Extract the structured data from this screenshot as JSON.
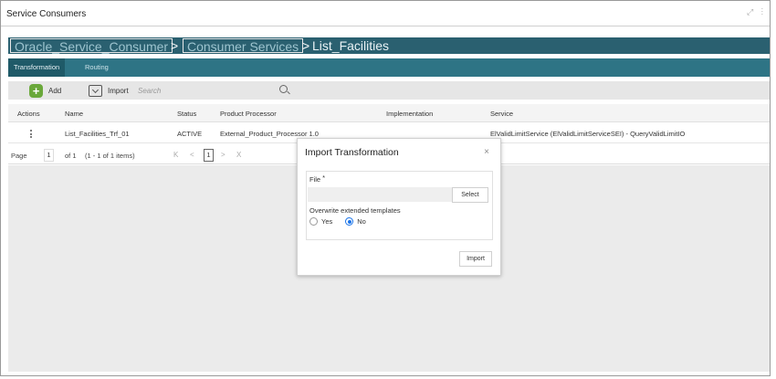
{
  "window": {
    "title": "Service Consumers",
    "controls": "⤢ ⁝"
  },
  "breadcrumb": {
    "items": [
      "Oracle_Service_Consumer",
      "Consumer Services",
      "List_Facilities"
    ],
    "separator": ">"
  },
  "tabs": [
    {
      "label": "Transformation",
      "active": true
    },
    {
      "label": "Routing",
      "active": false
    }
  ],
  "toolbar": {
    "add_label": "Add",
    "import_label": "Import",
    "search_placeholder": "Search"
  },
  "table": {
    "headers": [
      "Actions",
      "Name",
      "Status",
      "Product Processor",
      "Implementation",
      "Service"
    ],
    "rows": [
      {
        "name": "List_Facilities_Trf_01",
        "status": "ACTIVE",
        "product_processor": "External_Product_Processor 1.0",
        "implementation": "",
        "service": "ElValidLimitService (ElValidLimitServiceSEI) - QueryValidLimitIO"
      }
    ]
  },
  "pager": {
    "page_label": "Page",
    "page_value": "1",
    "of_label": "of 1",
    "items_label": "(1 - 1 of 1 items)",
    "first": "K",
    "prev": "<",
    "current": "1",
    "next": ">",
    "last": "X"
  },
  "modal": {
    "title": "Import Transformation",
    "close": "×",
    "file_label": "File",
    "required_mark": "*",
    "select_label": "Select",
    "overwrite_label": "Overwrite extended templates",
    "radio_yes": "Yes",
    "radio_no": "No",
    "selected": "No",
    "import_label": "Import"
  },
  "colors": {
    "breadcrumb_bg": "#2a6070",
    "tab_bar_bg": "#2e7485",
    "add_icon": "#6aa83a",
    "radio_selected": "#1a73e8"
  }
}
